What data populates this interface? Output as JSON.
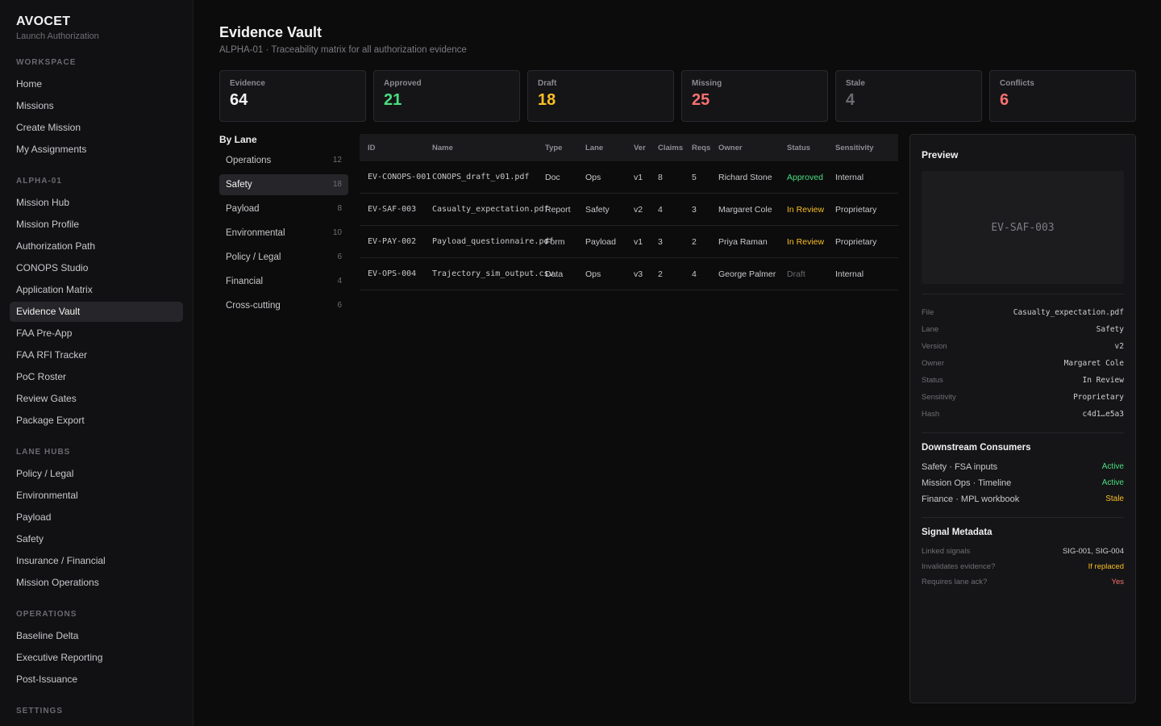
{
  "brand": {
    "name": "AVOCET",
    "subtitle": "Launch Authorization"
  },
  "nav": {
    "workspace": {
      "heading": "WORKSPACE",
      "items": [
        "Home",
        "Missions",
        "Create Mission",
        "My Assignments"
      ]
    },
    "mission": {
      "heading": "ALPHA-01",
      "items": [
        "Mission Hub",
        "Mission Profile",
        "Authorization Path",
        "CONOPS Studio",
        "Application Matrix",
        "Evidence Vault",
        "FAA Pre-App",
        "FAA RFI Tracker",
        "PoC Roster",
        "Review Gates",
        "Package Export"
      ]
    },
    "lane_hubs": {
      "heading": "LANE HUBS",
      "items": [
        "Policy / Legal",
        "Environmental",
        "Payload",
        "Safety",
        "Insurance / Financial",
        "Mission Operations"
      ]
    },
    "operations": {
      "heading": "OPERATIONS",
      "items": [
        "Baseline Delta",
        "Executive Reporting",
        "Post-Issuance"
      ]
    },
    "settings": {
      "heading": "SETTINGS"
    }
  },
  "page": {
    "title": "Evidence Vault",
    "subtitle": "ALPHA-01 · Traceability matrix for all authorization evidence"
  },
  "stats": [
    {
      "label": "Evidence",
      "value": "64",
      "color": "#f2f2f2"
    },
    {
      "label": "Approved",
      "value": "21",
      "color": "#4ade80"
    },
    {
      "label": "Draft",
      "value": "18",
      "color": "#fbbf24"
    },
    {
      "label": "Missing",
      "value": "25",
      "color": "#f87171"
    },
    {
      "label": "Stale",
      "value": "4",
      "color": "#6b6b70"
    },
    {
      "label": "Conflicts",
      "value": "6",
      "color": "#f87171"
    }
  ],
  "lanes": {
    "title": "By Lane",
    "items": [
      {
        "label": "Operations",
        "count": "12"
      },
      {
        "label": "Safety",
        "count": "18"
      },
      {
        "label": "Payload",
        "count": "8"
      },
      {
        "label": "Environmental",
        "count": "10"
      },
      {
        "label": "Policy / Legal",
        "count": "6"
      },
      {
        "label": "Financial",
        "count": "4"
      },
      {
        "label": "Cross-cutting",
        "count": "6"
      }
    ]
  },
  "table": {
    "headers": {
      "id": "ID",
      "name": "Name",
      "type": "Type",
      "lane": "Lane",
      "ver": "Ver",
      "claims": "Claims",
      "reqs": "Reqs",
      "owner": "Owner",
      "status": "Status",
      "sensitivity": "Sensitivity"
    },
    "rows": [
      {
        "id": "EV-CONOPS-001",
        "name": "CONOPS_draft_v01.pdf",
        "type": "Doc",
        "lane": "Ops",
        "ver": "v1",
        "claims": "8",
        "reqs": "5",
        "owner": "Richard Stone",
        "status": "Approved",
        "status_color": "#4ade80",
        "sensitivity": "Internal"
      },
      {
        "id": "EV-SAF-003",
        "name": "Casualty_expectation.pdf",
        "type": "Report",
        "lane": "Safety",
        "ver": "v2",
        "claims": "4",
        "reqs": "3",
        "owner": "Margaret Cole",
        "status": "In Review",
        "status_color": "#fbbf24",
        "sensitivity": "Proprietary"
      },
      {
        "id": "EV-PAY-002",
        "name": "Payload_questionnaire.pdf",
        "type": "Form",
        "lane": "Payload",
        "ver": "v1",
        "claims": "3",
        "reqs": "2",
        "owner": "Priya Raman",
        "status": "In Review",
        "status_color": "#fbbf24",
        "sensitivity": "Proprietary"
      },
      {
        "id": "EV-OPS-004",
        "name": "Trajectory_sim_output.csv",
        "type": "Data",
        "lane": "Ops",
        "ver": "v3",
        "claims": "2",
        "reqs": "4",
        "owner": "George Palmer",
        "status": "Draft",
        "status_color": "#6b6b70",
        "sensitivity": "Internal"
      }
    ]
  },
  "preview": {
    "title": "Preview",
    "doc_id": "EV-SAF-003",
    "fields": [
      {
        "k": "File",
        "v": "Casualty_expectation.pdf"
      },
      {
        "k": "Lane",
        "v": "Safety"
      },
      {
        "k": "Version",
        "v": "v2"
      },
      {
        "k": "Owner",
        "v": "Margaret Cole"
      },
      {
        "k": "Status",
        "v": "In Review"
      },
      {
        "k": "Sensitivity",
        "v": "Proprietary"
      },
      {
        "k": "Hash",
        "v": "c4d1…e5a3"
      }
    ],
    "consumers_title": "Downstream Consumers",
    "consumers": [
      {
        "name": "Safety · FSA inputs",
        "status": "Active",
        "color": "#4ade80"
      },
      {
        "name": "Mission Ops · Timeline",
        "status": "Active",
        "color": "#4ade80"
      },
      {
        "name": "Finance · MPL workbook",
        "status": "Stale",
        "color": "#fbbf24"
      }
    ],
    "signal_title": "Signal Metadata",
    "signals": [
      {
        "k": "Linked signals",
        "v": "SIG-001, SIG-004",
        "color": "#cfcfd3"
      },
      {
        "k": "Invalidates evidence?",
        "v": "If replaced",
        "color": "#fbbf24"
      },
      {
        "k": "Requires lane ack?",
        "v": "Yes",
        "color": "#f87171"
      }
    ]
  }
}
